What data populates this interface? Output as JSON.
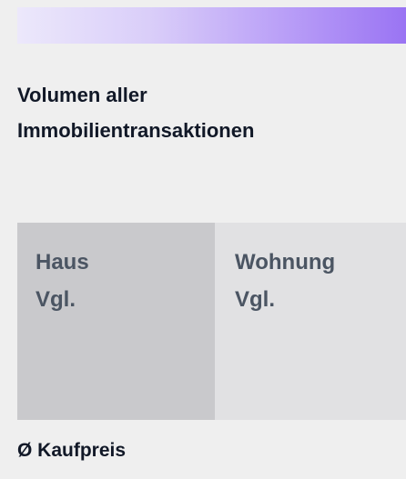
{
  "header": {
    "gradient_start": "#ece8fb",
    "gradient_end": "#9a74f3"
  },
  "section": {
    "title_line1": "Volumen aller",
    "title_line2": "Immobilientransaktionen"
  },
  "tabs": [
    {
      "label": "Haus",
      "sublabel": "Vgl.",
      "selected": true,
      "color": "#c9c9cc"
    },
    {
      "label": "Wohnung",
      "sublabel": "Vgl.",
      "selected": false,
      "color": "#e1e1e3"
    }
  ],
  "footer": {
    "label": "Ø Kaufpreis"
  }
}
